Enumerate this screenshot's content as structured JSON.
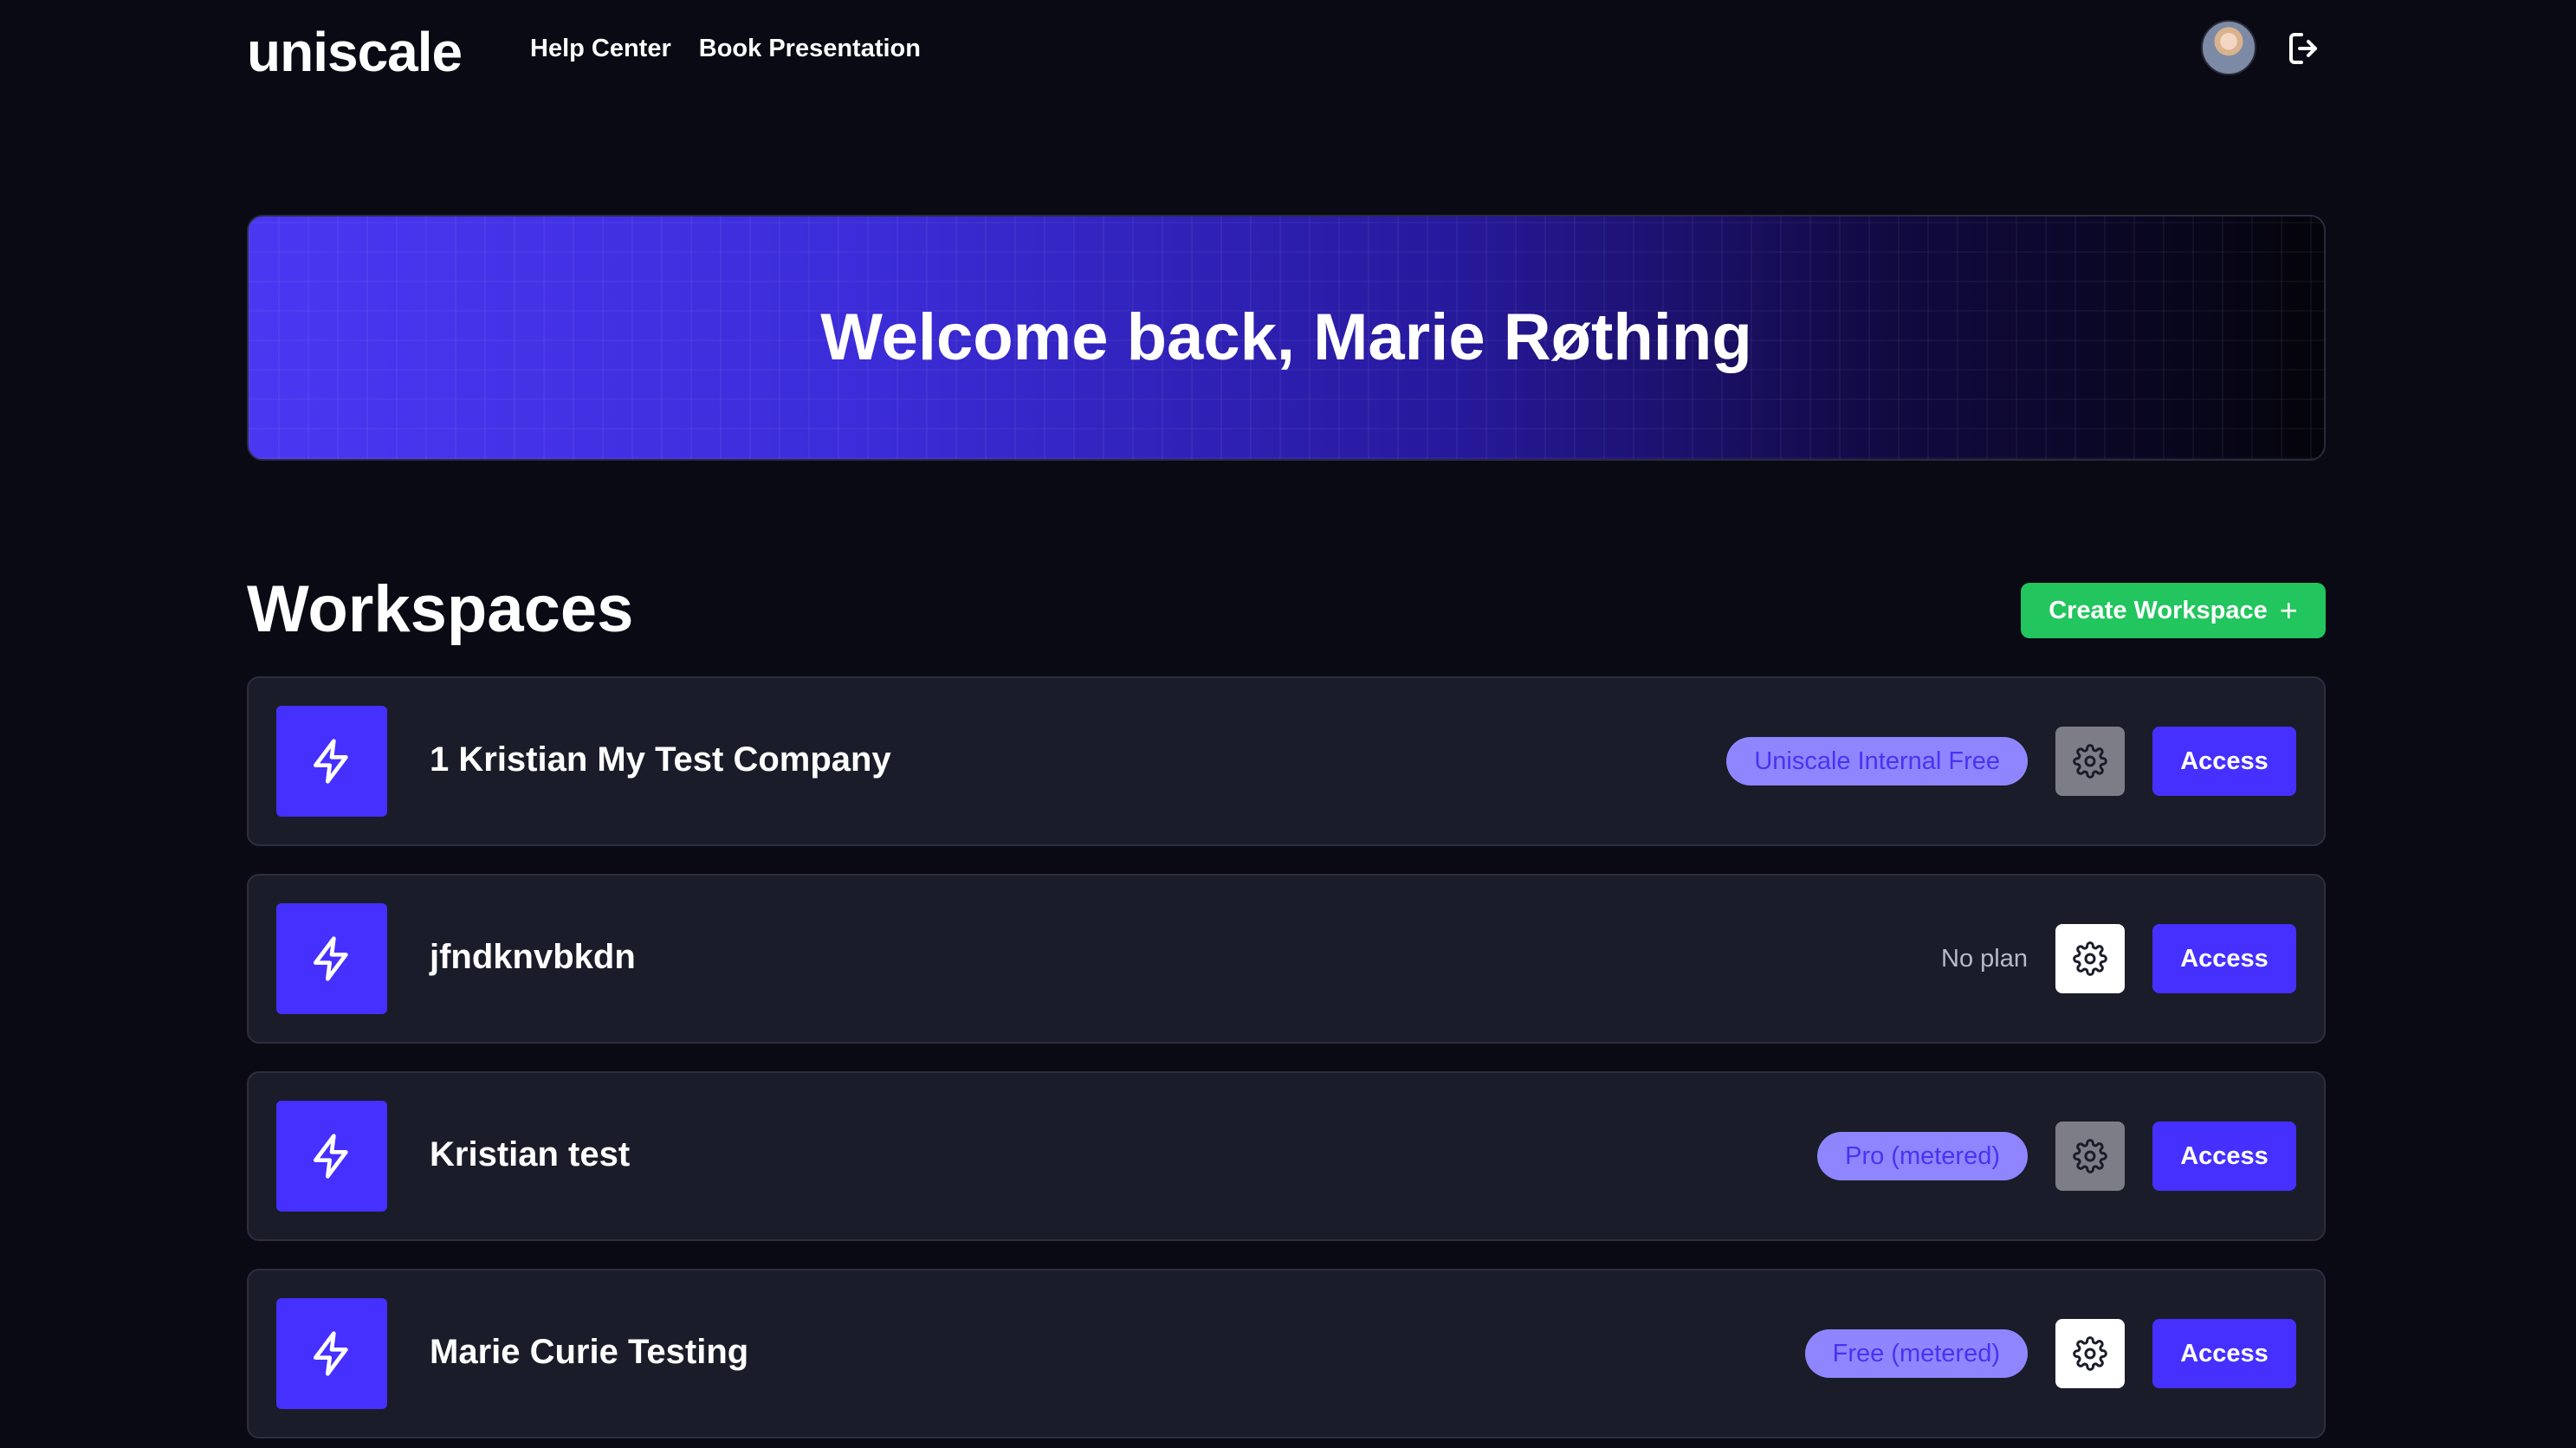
{
  "header": {
    "logo_text": "uniscale",
    "nav": [
      "Help Center",
      "Book Presentation"
    ],
    "avatar_icon": "user-avatar",
    "logout_icon": "logout-icon"
  },
  "hero": {
    "title": "Welcome back, Marie Røthing"
  },
  "workspaces": {
    "title": "Workspaces",
    "create_label": "Create Workspace",
    "create_icon": "plus-icon",
    "items": [
      {
        "name": "1 Kristian My Test Company",
        "plan": "Uniscale Internal Free",
        "plan_style": "badge",
        "gear_style": "grey",
        "access_label": "Access"
      },
      {
        "name": "jfndknvbkdn",
        "plan": "No plan",
        "plan_style": "text",
        "gear_style": "white",
        "access_label": "Access"
      },
      {
        "name": "Kristian test",
        "plan": "Pro (metered)",
        "plan_style": "badge",
        "gear_style": "grey",
        "access_label": "Access"
      },
      {
        "name": "Marie Curie Testing",
        "plan": "Free (metered)",
        "plan_style": "badge",
        "gear_style": "white",
        "access_label": "Access"
      }
    ]
  },
  "colors": {
    "background": "#0a0a14",
    "accent": "#4530ff",
    "create_button": "#22c55e",
    "card": "#1b1c29",
    "badge": "#8f86ff"
  }
}
